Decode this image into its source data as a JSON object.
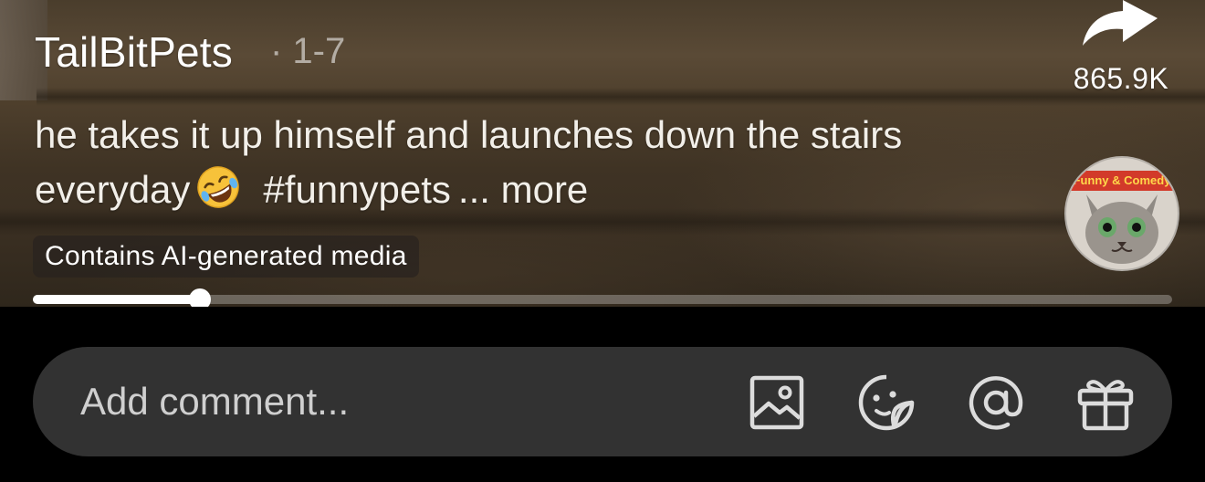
{
  "post": {
    "username": "TailBitPets",
    "date": "· 1-7",
    "caption_text": "he takes it up himself and launches down the stairs everyday",
    "caption_emoji": "rolling-on-floor-laughing-emoji",
    "hashtag": "#funnypets",
    "more_label": "... more",
    "ai_badge": "Contains AI-generated media"
  },
  "actions": {
    "share_icon": "share-arrow-icon",
    "share_count": "865.9K"
  },
  "music": {
    "disc_banner": "Funny & Comedy"
  },
  "playback": {
    "progress_fraction": 0.147
  },
  "comment_bar": {
    "placeholder": "Add comment...",
    "icons": [
      "image-icon",
      "sticker-icon",
      "mention-icon",
      "gift-icon"
    ]
  },
  "colors": {
    "background": "#000000",
    "comment_bar": "#323232",
    "progress_fill": "#ffffff"
  }
}
